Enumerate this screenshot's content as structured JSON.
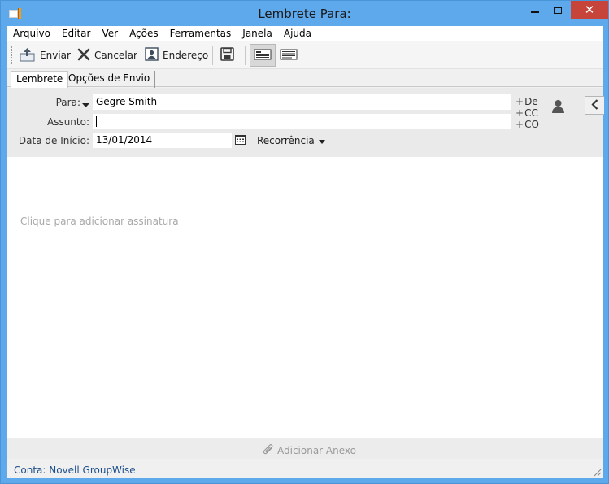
{
  "window": {
    "title": "Lembrete Para:"
  },
  "menu": [
    "Arquivo",
    "Editar",
    "Ver",
    "Ações",
    "Ferramentas",
    "Janela",
    "Ajuda"
  ],
  "toolbar": {
    "send_label": "Enviar",
    "cancel_label": "Cancelar",
    "address_label": "Endereço"
  },
  "tabs": [
    "Lembrete",
    "Opções de Envio"
  ],
  "form": {
    "to_label": "Para:",
    "to_value": "Gegre Smith",
    "subject_label": "Assunto:",
    "subject_value": "",
    "start_label": "Data de Início:",
    "start_value": "13/01/2014",
    "recurrence_label": "Recorrência",
    "add_from": "De",
    "add_cc": "CC",
    "add_bc": "CO"
  },
  "body": {
    "signature_hint": "Clique para adicionar assinatura"
  },
  "attach": {
    "label": "Adicionar Anexo"
  },
  "status": {
    "text": "Conta: Novell GroupWise"
  },
  "colors": {
    "titlebar": "#5ea9ec",
    "close": "#c7443a",
    "status_text": "#1d4f8a"
  }
}
